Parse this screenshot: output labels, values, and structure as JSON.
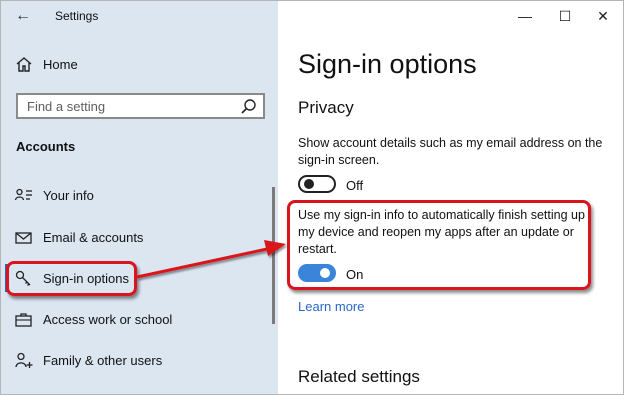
{
  "window": {
    "title": "Settings",
    "controls": {
      "minimize": "—",
      "maximize": "☐",
      "close": "✕"
    }
  },
  "sidebar": {
    "back_icon": "←",
    "home_label": "Home",
    "search_placeholder": "Find a setting",
    "section_title": "Accounts",
    "items": [
      {
        "label": "Your info",
        "icon": "user-info-icon"
      },
      {
        "label": "Email & accounts",
        "icon": "mail-icon"
      },
      {
        "label": "Sign-in options",
        "icon": "key-icon",
        "selected": true
      },
      {
        "label": "Access work or school",
        "icon": "briefcase-icon"
      },
      {
        "label": "Family & other users",
        "icon": "person-add-icon"
      }
    ]
  },
  "main": {
    "title": "Sign-in options",
    "privacy_heading": "Privacy",
    "setting1": {
      "description": "Show account details such as my email address on the sign-in screen.",
      "state": "Off"
    },
    "setting2": {
      "description": "Use my sign-in info to automatically finish setting up my device and reopen my apps after an update or restart.",
      "state": "On"
    },
    "learn_more": "Learn more",
    "related_heading": "Related settings"
  },
  "colors": {
    "sidebar_bg": "#dbe6f1",
    "accent": "#2b67c5",
    "toggle_on": "#3a84d9",
    "annotation_red": "#d9141f"
  }
}
